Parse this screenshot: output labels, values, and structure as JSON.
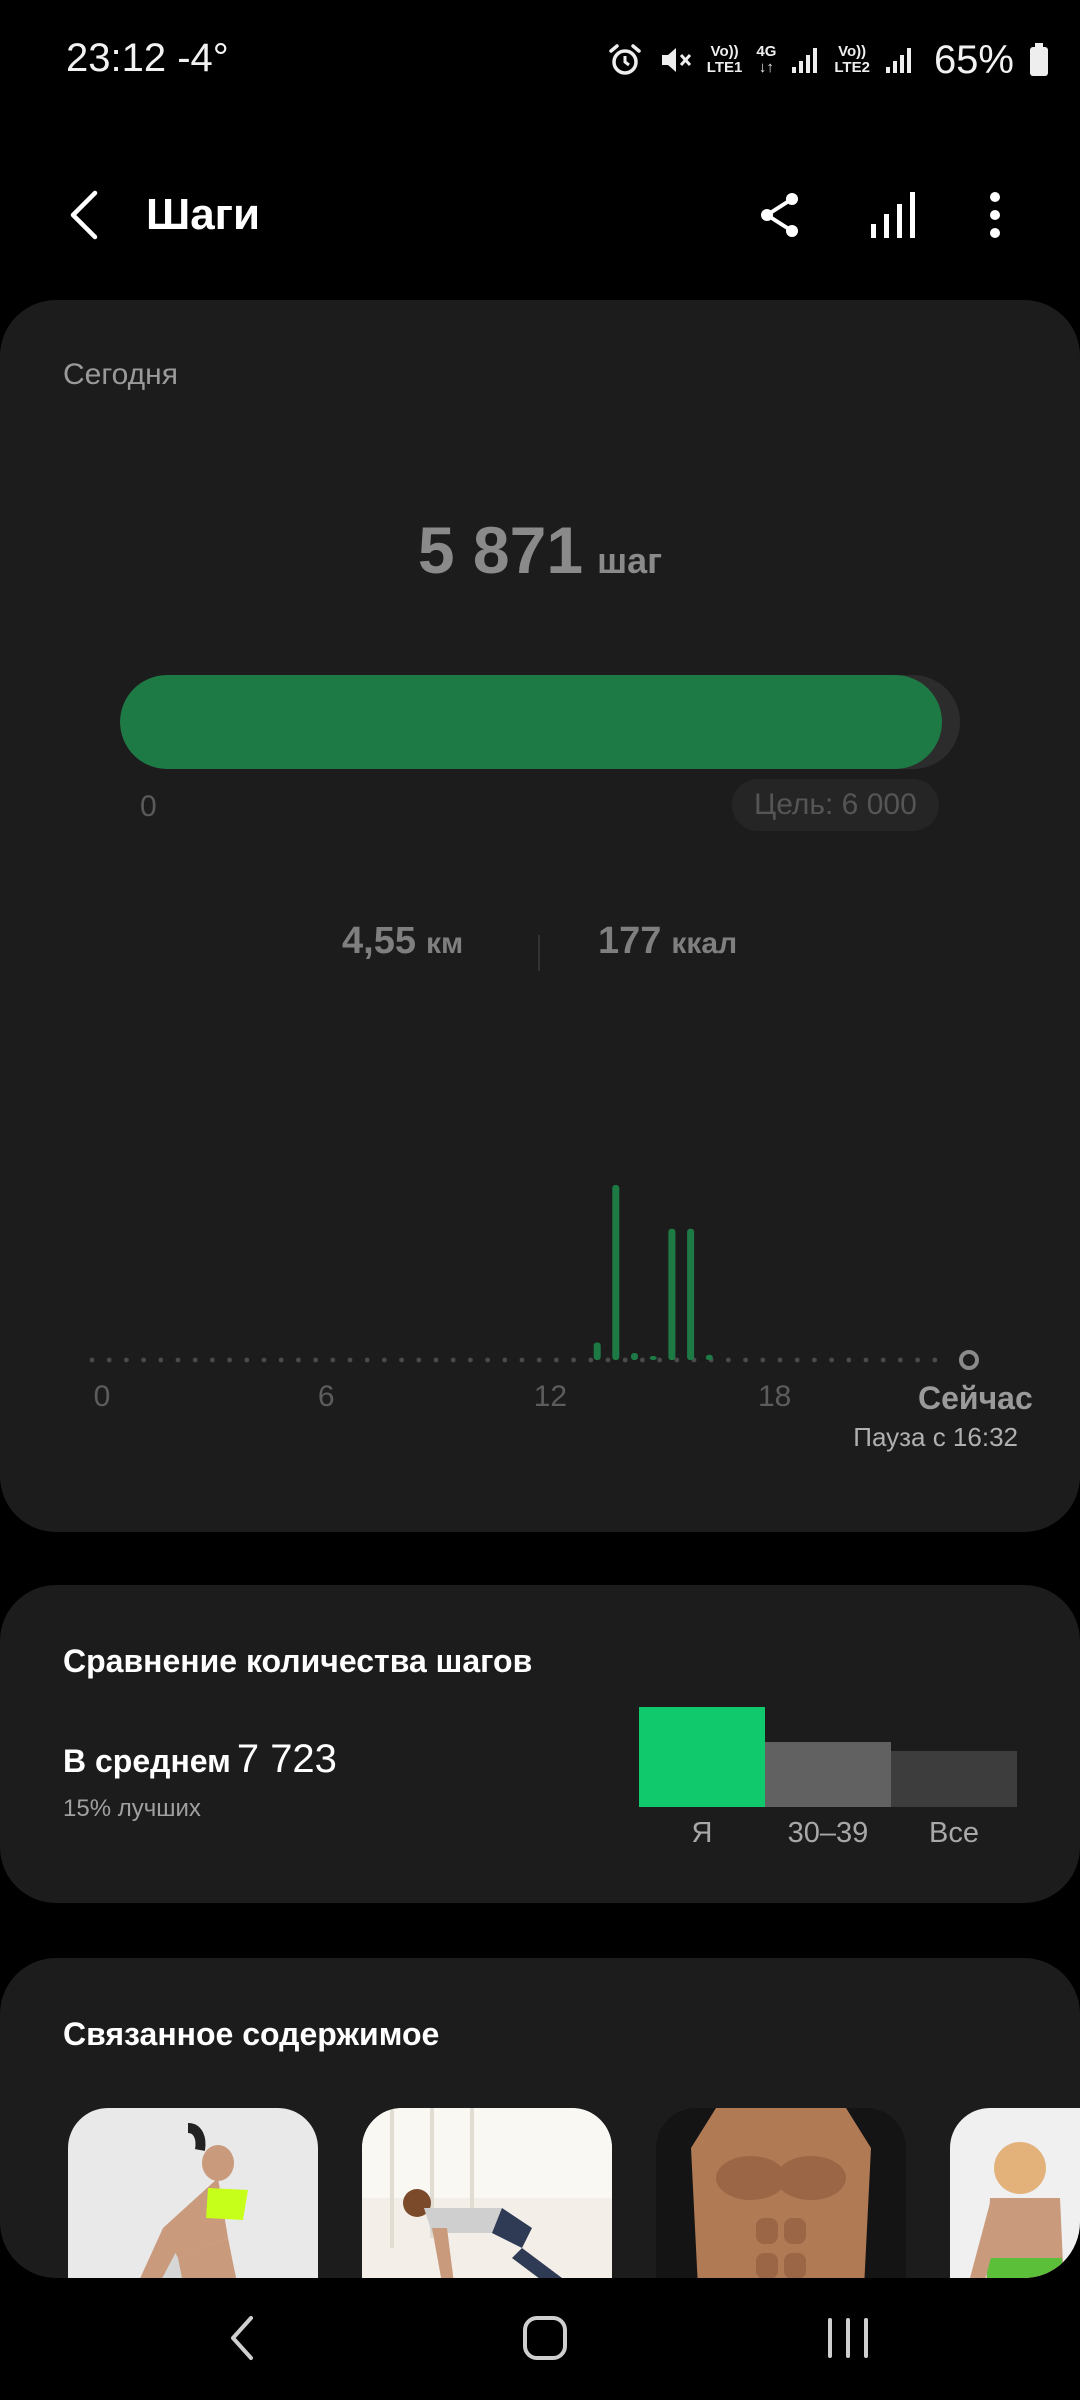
{
  "status_bar": {
    "time_temp": "23:12 -4°",
    "sim1": {
      "vo": "Vo))",
      "lte": "LTE1"
    },
    "net": {
      "g": "4G",
      "arrows": "↓↑"
    },
    "sim2": {
      "vo": "Vo))",
      "lte": "LTE2"
    },
    "battery": "65%",
    "icons": [
      "alarm-icon",
      "mute-icon",
      "signal-icon",
      "battery-icon"
    ]
  },
  "header": {
    "title": "Шаги",
    "icons": [
      "back-icon",
      "share-icon",
      "bar-chart-icon",
      "more-vert-icon"
    ]
  },
  "today": {
    "label": "Сегодня",
    "steps": "5 871",
    "steps_unit": "шаг",
    "progress_fraction": 0.9785,
    "progress_start": "0",
    "goal": "Цель: 6 000",
    "distance": "4,55",
    "distance_unit": "км",
    "calories": "177",
    "calories_unit": "ккал",
    "pause": "Пауза с 16:32"
  },
  "chart_data": {
    "type": "bar",
    "title": "",
    "x_tick_labels": [
      "0",
      "6",
      "12",
      "18",
      "Сейчас"
    ],
    "x_ticks": [
      0,
      6,
      12,
      18
    ],
    "x_now": 23.2,
    "xlim": [
      0,
      23.2
    ],
    "x": [
      13.25,
      13.75,
      14.25,
      14.75,
      15.25,
      15.75,
      16.25
    ],
    "values": [
      10,
      100,
      4,
      0,
      75,
      75,
      3
    ],
    "ylim": [
      0,
      100
    ],
    "bar_color": "#1e7a45",
    "grid": false
  },
  "compare": {
    "title": "Сравнение количества шагов",
    "avg_label": "В среднем",
    "avg_value": "7 723",
    "better": "15% лучших",
    "bars": [
      {
        "label": "Я",
        "level": 1.0,
        "color": "#10c96c"
      },
      {
        "label": "30–39",
        "level": 0.65,
        "color": "#616161"
      },
      {
        "label": "Все",
        "level": 0.56,
        "color": "#3d3d3d"
      }
    ]
  },
  "related": {
    "title": "Связанное содержимое"
  },
  "nav": {
    "icons": [
      "nav-back-icon",
      "nav-home-icon",
      "nav-recents-icon"
    ]
  }
}
